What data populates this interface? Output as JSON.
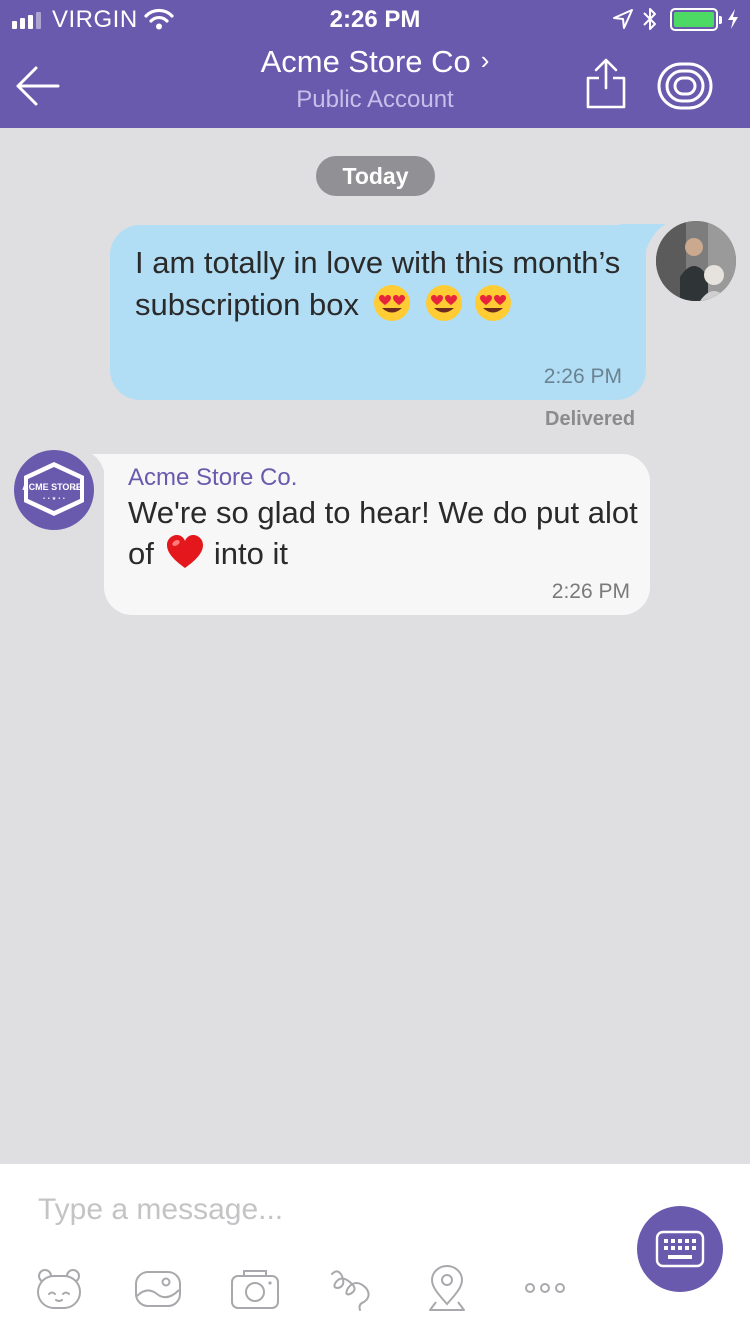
{
  "status_bar": {
    "carrier": "VIRGIN",
    "time": "2:26 PM"
  },
  "header": {
    "title": "Acme Store Co",
    "subtitle": "Public Account",
    "background": "#6a5aae"
  },
  "chat": {
    "date_pill": "Today",
    "messages": [
      {
        "direction": "outgoing",
        "text": "I am totally in love with this month’s subscription box",
        "emoji": "heart-eyes-face x3",
        "time": "2:26 PM",
        "status": "Delivered"
      },
      {
        "direction": "incoming",
        "sender": "Acme Store Co.",
        "text_before": "We're so glad to hear! We do put alot of",
        "text_after": "into it",
        "emoji": "red-heart",
        "time": "2:26 PM"
      }
    ],
    "store_logo_text": "ACME STORE",
    "store_logo_small": "CO."
  },
  "composer": {
    "placeholder": "Type a message..."
  },
  "colors": {
    "accent": "#6a5aae",
    "outgoing_bubble": "#b1def5",
    "incoming_bubble": "#f7f7f7",
    "chat_background": "#dfdfe1"
  }
}
